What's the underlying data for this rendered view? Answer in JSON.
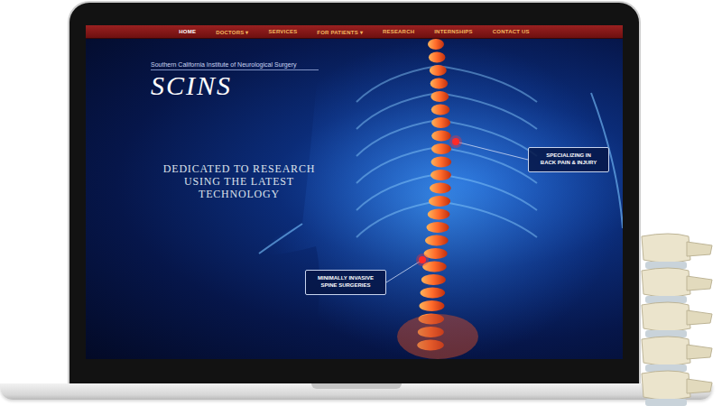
{
  "nav": {
    "caret": "▾",
    "items": [
      {
        "label": "HOME",
        "selected": true,
        "dropdown": false
      },
      {
        "label": "DOCTORS",
        "selected": false,
        "dropdown": true
      },
      {
        "label": "SERVICES",
        "selected": false,
        "dropdown": false
      },
      {
        "label": "FOR PATIENTS",
        "selected": false,
        "dropdown": true
      },
      {
        "label": "RESEARCH",
        "selected": false,
        "dropdown": false
      },
      {
        "label": "INTERNSHIPS",
        "selected": false,
        "dropdown": false
      },
      {
        "label": "CONTACT US",
        "selected": false,
        "dropdown": false
      }
    ]
  },
  "logo": {
    "subtitle": "Southern California Institute of Neurological Surgery",
    "mark": "SCINS"
  },
  "hero": {
    "headline": [
      "DEDICATED TO RESEARCH",
      "USING THE LATEST",
      "TECHNOLOGY"
    ]
  },
  "callouts": [
    {
      "lines": [
        "SPECIALIZING IN",
        "BACK PAIN & INJURY"
      ]
    },
    {
      "lines": [
        "MINIMALLY INVASIVE",
        "SPINE SURGERIES"
      ]
    }
  ]
}
